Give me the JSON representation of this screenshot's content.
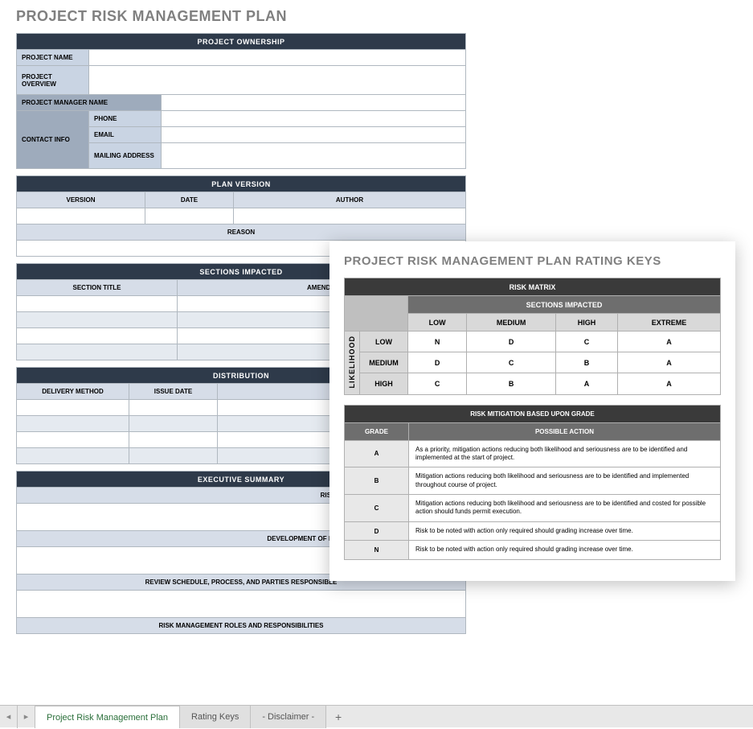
{
  "pageTitle": "PROJECT RISK MANAGEMENT PLAN",
  "ownership": {
    "header": "PROJECT OWNERSHIP",
    "projectNameLabel": "PROJECT NAME",
    "projectOverviewLabel": "PROJECT OVERVIEW",
    "projectManagerLabel": "PROJECT MANAGER NAME",
    "contactInfoLabel": "CONTACT INFO",
    "phoneLabel": "PHONE",
    "emailLabel": "EMAIL",
    "mailingLabel": "MAILING ADDRESS"
  },
  "planVersion": {
    "header": "PLAN VERSION",
    "versionCol": "VERSION",
    "dateCol": "DATE",
    "authorCol": "AUTHOR",
    "reasonLabel": "REASON"
  },
  "sectionsImpacted": {
    "header": "SECTIONS IMPACTED",
    "sectionTitleCol": "SECTION TITLE",
    "amendCol": "AMENDM"
  },
  "distribution": {
    "header": "DISTRIBUTION",
    "deliveryCol": "DELIVERY METHOD",
    "issueDateCol": "ISSUE DATE"
  },
  "execSummary": {
    "header": "EXECUTIVE SUMMARY",
    "sub1": "RISK ANALYSIS AND EVALUATION PROCESS",
    "sub2": "DEVELOPMENT OF RISK PREVENTION MITIGATION STRATEGI",
    "sub3": "REVIEW SCHEDULE, PROCESS, AND PARTIES RESPONSIBLE",
    "sub4": "RISK MANAGEMENT ROLES AND RESPONSIBILITIES"
  },
  "overlay": {
    "title": "PROJECT RISK MANAGEMENT PLAN RATING KEYS",
    "matrix": {
      "header": "RISK MATRIX",
      "sectionsImpacted": "SECTIONS IMPACTED",
      "likelihood": "LIKELIHOOD",
      "cols": [
        "LOW",
        "MEDIUM",
        "HIGH",
        "EXTREME"
      ],
      "rows": [
        "LOW",
        "MEDIUM",
        "HIGH"
      ],
      "values": [
        [
          "N",
          "D",
          "C",
          "A"
        ],
        [
          "D",
          "C",
          "B",
          "A"
        ],
        [
          "C",
          "B",
          "A",
          "A"
        ]
      ]
    },
    "mitigation": {
      "header": "RISK MITIGATION BASED UPON GRADE",
      "gradeCol": "GRADE",
      "actionCol": "POSSIBLE ACTION",
      "rows": [
        {
          "grade": "A",
          "action": "As a priority, mitigation actions reducing both likelihood and seriousness are to be identified and implemented at the start of project."
        },
        {
          "grade": "B",
          "action": "Mitigation actions reducing both likelihood and seriousness are to be identified and implemented throughout course of project."
        },
        {
          "grade": "C",
          "action": "Mitigation actions reducing both likelihood and seriousness are to be identified and costed for possible action should funds permit execution."
        },
        {
          "grade": "D",
          "action": "Risk to be noted with action only required should grading increase over time."
        },
        {
          "grade": "N",
          "action": "Risk to be noted with action only required should grading increase over time."
        }
      ]
    }
  },
  "tabs": {
    "scrollLeft": "◂",
    "scrollRight": "▸",
    "tab1": "Project Risk Management Plan",
    "tab2": "Rating Keys",
    "tab3": "- Disclaimer -",
    "add": "+"
  }
}
